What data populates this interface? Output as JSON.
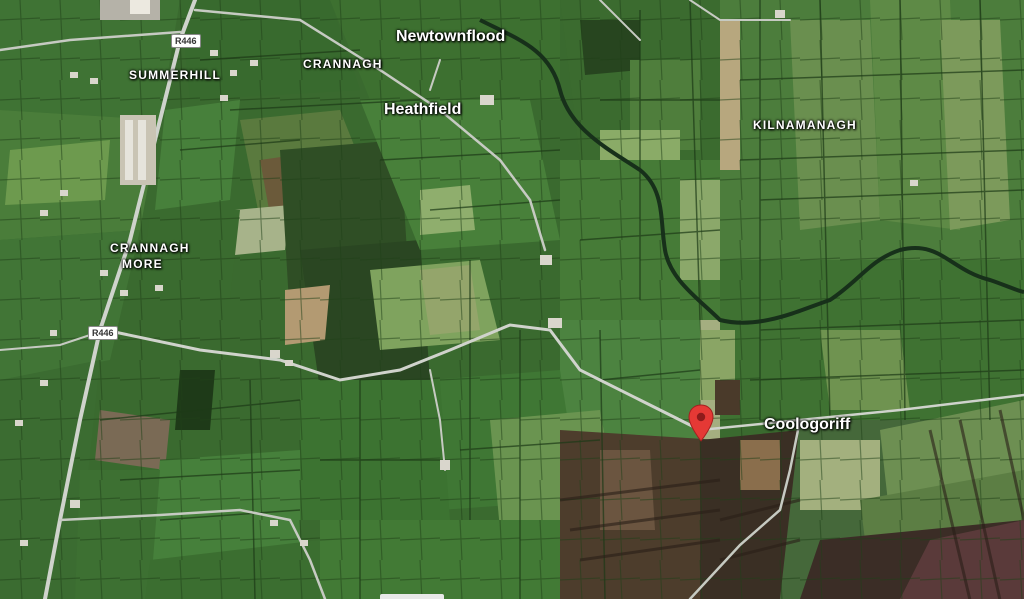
{
  "map": {
    "type": "satellite",
    "places": {
      "newtownflood": "Newtownflood",
      "heathfield": "Heathfield",
      "coologoriff": "Coologoriff"
    },
    "townlands": {
      "summerhill": "SUMMERHILL",
      "crannagh": "CRANNAGH",
      "kilnamanagh": "KILNAMANAGH",
      "crannagh_more_1": "CRANNAGH",
      "crannagh_more_2": "MORE"
    },
    "roads": {
      "r446_top": "R446",
      "r446_mid": "R446"
    },
    "marker": {
      "icon": "map-pin-icon",
      "color": "#e53935"
    }
  }
}
